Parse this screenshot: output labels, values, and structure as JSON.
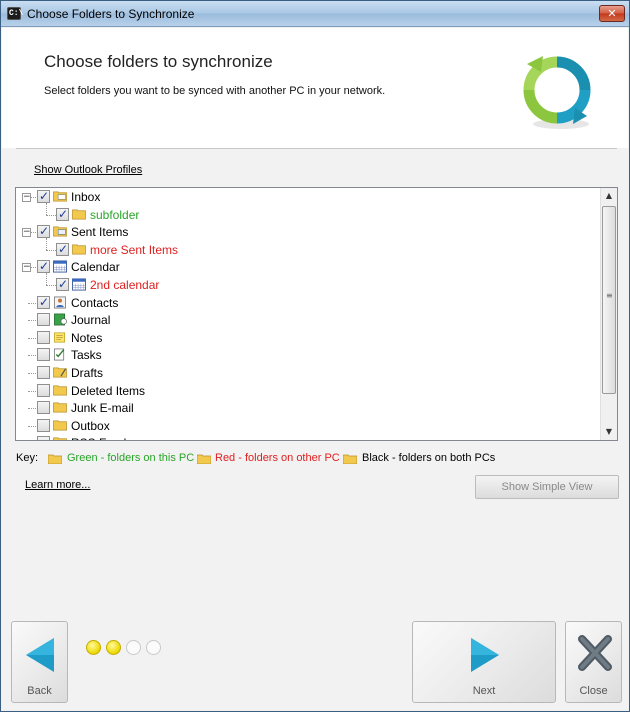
{
  "window": {
    "title": "Choose Folders to Synchronize",
    "app_icon_text": "C:\\"
  },
  "header": {
    "title": "Choose folders to synchronize",
    "subtitle": "Select folders you want to be synced with another PC in your network."
  },
  "show_profiles_label": "Show Outlook Profiles",
  "tree": {
    "rows": [
      {
        "label": "Inbox",
        "checked": true,
        "color": "black",
        "icon": "inbox-folder-icon"
      },
      {
        "label": "subfolder",
        "checked": true,
        "color": "green",
        "icon": "folder-icon"
      },
      {
        "label": "Sent Items",
        "checked": true,
        "color": "black",
        "icon": "sent-folder-icon"
      },
      {
        "label": "more Sent Items",
        "checked": true,
        "color": "red",
        "icon": "folder-icon"
      },
      {
        "label": "Calendar",
        "checked": true,
        "color": "black",
        "icon": "calendar-icon"
      },
      {
        "label": "2nd calendar",
        "checked": true,
        "color": "red",
        "icon": "calendar-icon"
      },
      {
        "label": "Contacts",
        "checked": true,
        "color": "black",
        "icon": "contacts-icon"
      },
      {
        "label": "Journal",
        "checked": false,
        "color": "black",
        "icon": "journal-icon"
      },
      {
        "label": "Notes",
        "checked": false,
        "color": "black",
        "icon": "notes-icon"
      },
      {
        "label": "Tasks",
        "checked": false,
        "color": "black",
        "icon": "tasks-icon"
      },
      {
        "label": "Drafts",
        "checked": false,
        "color": "black",
        "icon": "drafts-icon"
      },
      {
        "label": "Deleted Items",
        "checked": false,
        "color": "black",
        "icon": "folder-icon"
      },
      {
        "label": "Junk E-mail",
        "checked": false,
        "color": "black",
        "icon": "folder-icon"
      },
      {
        "label": "Outbox",
        "checked": false,
        "color": "black",
        "icon": "folder-icon"
      },
      {
        "label": "RSS Feeds",
        "checked": false,
        "color": "black",
        "icon": "folder-icon"
      }
    ]
  },
  "key": {
    "label": "Key:",
    "items": [
      {
        "text": "Green - folders on this PC",
        "color": "#2aa52a"
      },
      {
        "text": "Red - folders on other PC",
        "color": "#e02020"
      },
      {
        "text": "Black - folders on both PCs",
        "color": "#000000"
      }
    ]
  },
  "learn_more_label": "Learn more...",
  "show_simple_view_label": "Show Simple View",
  "progress": {
    "total_steps": 4,
    "current_step": 2
  },
  "nav": {
    "back_label": "Back",
    "next_label": "Next",
    "close_label": "Close"
  },
  "colors": {
    "accent_teal": "#1a8fb0",
    "brand_green": "#8cc63f"
  }
}
